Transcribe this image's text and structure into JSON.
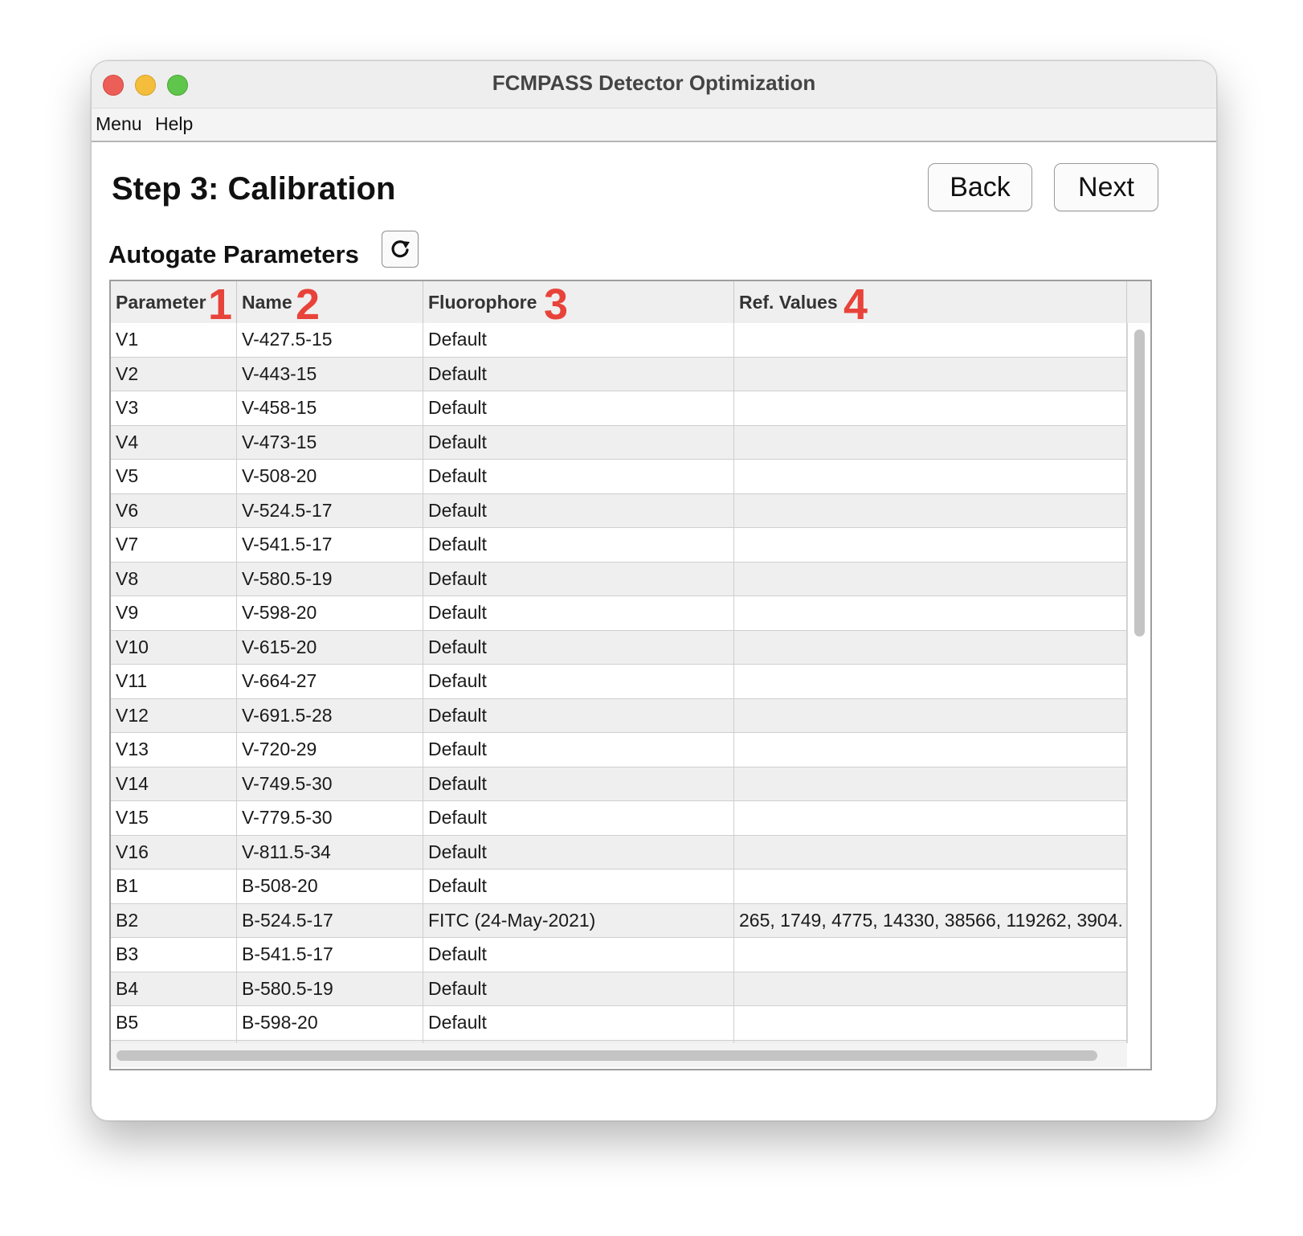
{
  "window": {
    "title": "FCMPASS Detector Optimization"
  },
  "menubar": {
    "items": [
      "Menu",
      "Help"
    ]
  },
  "page": {
    "step_title": "Step 3: Calibration",
    "back_label": "Back",
    "next_label": "Next",
    "section_title": "Autogate Parameters",
    "refresh_icon": "refresh-icon"
  },
  "table": {
    "columns": [
      {
        "label": "Parameter",
        "badge": "1"
      },
      {
        "label": "Name",
        "badge": "2"
      },
      {
        "label": "Fluorophore",
        "badge": "3"
      },
      {
        "label": "Ref. Values",
        "badge": "4"
      }
    ],
    "rows": [
      {
        "param": "V1",
        "name": "V-427.5-15",
        "fluorophore": "Default",
        "ref": ""
      },
      {
        "param": "V2",
        "name": "V-443-15",
        "fluorophore": "Default",
        "ref": ""
      },
      {
        "param": "V3",
        "name": "V-458-15",
        "fluorophore": "Default",
        "ref": ""
      },
      {
        "param": "V4",
        "name": "V-473-15",
        "fluorophore": "Default",
        "ref": ""
      },
      {
        "param": "V5",
        "name": "V-508-20",
        "fluorophore": "Default",
        "ref": ""
      },
      {
        "param": "V6",
        "name": "V-524.5-17",
        "fluorophore": "Default",
        "ref": ""
      },
      {
        "param": "V7",
        "name": "V-541.5-17",
        "fluorophore": "Default",
        "ref": ""
      },
      {
        "param": "V8",
        "name": "V-580.5-19",
        "fluorophore": "Default",
        "ref": ""
      },
      {
        "param": "V9",
        "name": "V-598-20",
        "fluorophore": "Default",
        "ref": ""
      },
      {
        "param": "V10",
        "name": "V-615-20",
        "fluorophore": "Default",
        "ref": ""
      },
      {
        "param": "V11",
        "name": "V-664-27",
        "fluorophore": "Default",
        "ref": ""
      },
      {
        "param": "V12",
        "name": "V-691.5-28",
        "fluorophore": "Default",
        "ref": ""
      },
      {
        "param": "V13",
        "name": "V-720-29",
        "fluorophore": "Default",
        "ref": ""
      },
      {
        "param": "V14",
        "name": "V-749.5-30",
        "fluorophore": "Default",
        "ref": ""
      },
      {
        "param": "V15",
        "name": "V-779.5-30",
        "fluorophore": "Default",
        "ref": ""
      },
      {
        "param": "V16",
        "name": "V-811.5-34",
        "fluorophore": "Default",
        "ref": ""
      },
      {
        "param": "B1",
        "name": "B-508-20",
        "fluorophore": "Default",
        "ref": ""
      },
      {
        "param": "B2",
        "name": "B-524.5-17",
        "fluorophore": "FITC (24-May-2021)",
        "ref": "265, 1749, 4775, 14330, 38566, 119262, 3904."
      },
      {
        "param": "B3",
        "name": "B-541.5-17",
        "fluorophore": "Default",
        "ref": ""
      },
      {
        "param": "B4",
        "name": "B-580.5-19",
        "fluorophore": "Default",
        "ref": ""
      },
      {
        "param": "B5",
        "name": "B-598-20",
        "fluorophore": "Default",
        "ref": ""
      },
      {
        "param": "",
        "name": "",
        "fluorophore": "",
        "ref": ""
      }
    ]
  }
}
